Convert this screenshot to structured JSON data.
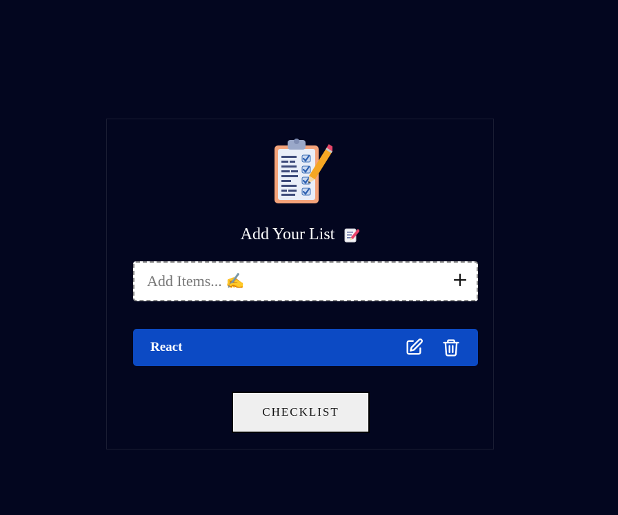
{
  "app": {
    "logo_icon": "clipboard-checklist-icon",
    "title": "Add Your List",
    "title_icon": "memo-icon"
  },
  "add_item": {
    "placeholder": "Add Items... ✍",
    "value": "",
    "add_icon": "plus-icon"
  },
  "items": [
    {
      "label": "React",
      "edit_icon": "edit-icon",
      "delete_icon": "trash-icon"
    }
  ],
  "checklist_button": {
    "label": "CHECKLIST"
  },
  "colors": {
    "background": "#03061f",
    "item_background": "#0c4ac4",
    "button_background": "#efefef"
  }
}
